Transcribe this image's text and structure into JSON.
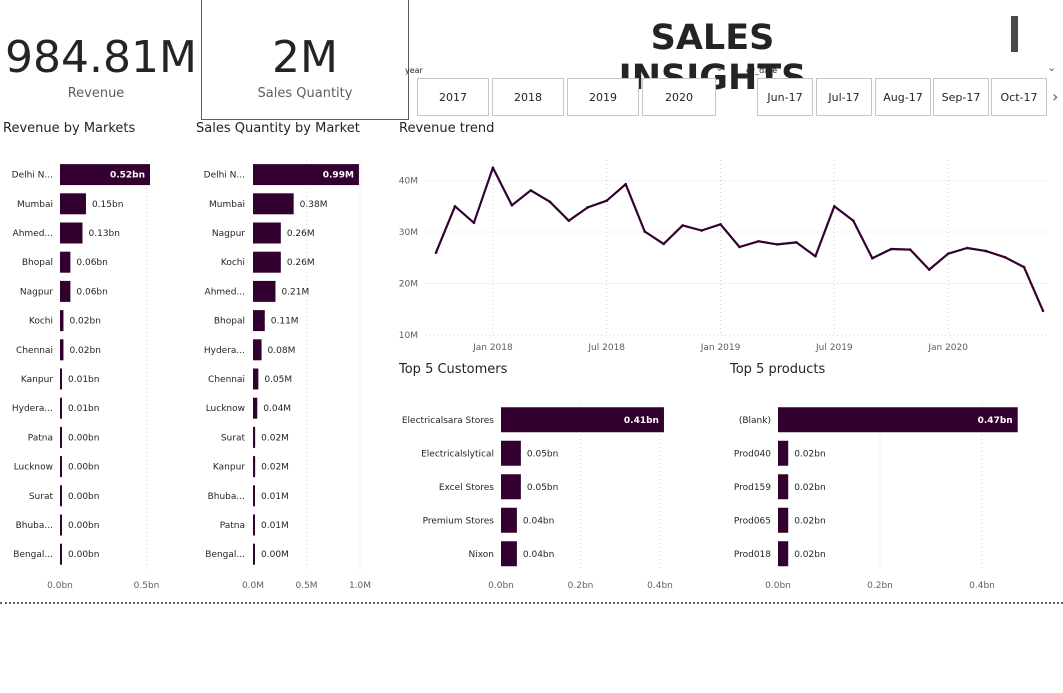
{
  "kpis": {
    "revenue": {
      "value": "984.81M",
      "label": "Revenue"
    },
    "quantity": {
      "value": "2M",
      "label": "Sales Quantity"
    }
  },
  "page_title": "SALES INSIGHTS",
  "year_slicer": {
    "label": "year",
    "options": [
      "2017",
      "2018",
      "2019",
      "2020"
    ]
  },
  "date_slicer": {
    "label": "cy_date",
    "options": [
      "Jun-17",
      "Jul-17",
      "Aug-17",
      "Sep-17",
      "Oct-17"
    ]
  },
  "colors": {
    "bar": "#33012f",
    "grid": "#d2d0ce",
    "text": "#252423",
    "muted": "#605e5c"
  },
  "chart_data": [
    {
      "id": "rev_markets",
      "type": "bar",
      "orientation": "horizontal",
      "title": "Revenue by Markets",
      "categories": [
        "Delhi N...",
        "Mumbai",
        "Ahmed...",
        "Bhopal",
        "Nagpur",
        "Kochi",
        "Chennai",
        "Kanpur",
        "Hydera...",
        "Patna",
        "Lucknow",
        "Surat",
        "Bhuba...",
        "Bengal..."
      ],
      "values": [
        0.52,
        0.15,
        0.13,
        0.06,
        0.06,
        0.02,
        0.02,
        0.01,
        0.01,
        0.0,
        0.0,
        0.0,
        0.0,
        0.0
      ],
      "data_labels": [
        "0.52bn",
        "0.15bn",
        "0.13bn",
        "0.06bn",
        "0.06bn",
        "0.02bn",
        "0.02bn",
        "0.01bn",
        "0.01bn",
        "0.00bn",
        "0.00bn",
        "0.00bn",
        "0.00bn",
        "0.00bn"
      ],
      "x_ticks": [
        {
          "v": 0,
          "label": "0.0bn"
        },
        {
          "v": 0.5,
          "label": "0.5bn"
        }
      ],
      "xlim": [
        0,
        0.52
      ]
    },
    {
      "id": "qty_markets",
      "type": "bar",
      "orientation": "horizontal",
      "title": "Sales Quantity by Market",
      "categories": [
        "Delhi N...",
        "Mumbai",
        "Nagpur",
        "Kochi",
        "Ahmed...",
        "Bhopal",
        "Hydera...",
        "Chennai",
        "Lucknow",
        "Surat",
        "Kanpur",
        "Bhuba...",
        "Patna",
        "Bengal..."
      ],
      "values": [
        0.99,
        0.38,
        0.26,
        0.26,
        0.21,
        0.11,
        0.08,
        0.05,
        0.04,
        0.02,
        0.02,
        0.01,
        0.01,
        0.0
      ],
      "data_labels": [
        "0.99M",
        "0.38M",
        "0.26M",
        "0.26M",
        "0.21M",
        "0.11M",
        "0.08M",
        "0.05M",
        "0.04M",
        "0.02M",
        "0.02M",
        "0.01M",
        "0.01M",
        "0.00M"
      ],
      "x_ticks": [
        {
          "v": 0,
          "label": "0.0M"
        },
        {
          "v": 0.5,
          "label": "0.5M"
        },
        {
          "v": 1.0,
          "label": "1.0M"
        }
      ],
      "xlim": [
        0,
        1.0
      ]
    },
    {
      "id": "rev_trend",
      "type": "line",
      "title": "Revenue trend",
      "x": [
        "2017-10",
        "2017-11",
        "2017-12",
        "2018-01",
        "2018-02",
        "2018-03",
        "2018-04",
        "2018-05",
        "2018-06",
        "2018-07",
        "2018-08",
        "2018-09",
        "2018-10",
        "2018-11",
        "2018-12",
        "2019-01",
        "2019-02",
        "2019-03",
        "2019-04",
        "2019-05",
        "2019-06",
        "2019-07",
        "2019-08",
        "2019-09",
        "2019-10",
        "2019-11",
        "2019-12",
        "2020-01",
        "2020-02",
        "2020-03",
        "2020-04",
        "2020-05",
        "2020-06"
      ],
      "y": [
        26.0,
        35.0,
        31.8,
        42.5,
        35.2,
        38.1,
        35.9,
        32.2,
        34.8,
        36.1,
        39.3,
        30.1,
        27.7,
        31.3,
        30.3,
        31.5,
        27.1,
        28.2,
        27.6,
        28.0,
        25.3,
        35.0,
        32.2,
        24.9,
        26.7,
        26.6,
        22.7,
        25.8,
        26.9,
        26.3,
        25.1,
        23.2,
        14.7
      ],
      "y_ticks": [
        {
          "v": 10,
          "label": "10M"
        },
        {
          "v": 20,
          "label": "20M"
        },
        {
          "v": 30,
          "label": "30M"
        },
        {
          "v": 40,
          "label": "40M"
        }
      ],
      "x_ticks": [
        {
          "i": 3,
          "label": "Jan 2018"
        },
        {
          "i": 9,
          "label": "Jul 2018"
        },
        {
          "i": 15,
          "label": "Jan 2019"
        },
        {
          "i": 21,
          "label": "Jul 2019"
        },
        {
          "i": 27,
          "label": "Jan 2020"
        }
      ],
      "ylim": [
        10,
        44
      ]
    },
    {
      "id": "top_customers",
      "type": "bar",
      "orientation": "horizontal",
      "title": "Top 5 Customers",
      "categories": [
        "Electricalsara Stores",
        "Electricalslytical",
        "Excel Stores",
        "Premium Stores",
        "Nixon"
      ],
      "values": [
        0.41,
        0.05,
        0.05,
        0.04,
        0.04
      ],
      "data_labels": [
        "0.41bn",
        "0.05bn",
        "0.05bn",
        "0.04bn",
        "0.04bn"
      ],
      "x_ticks": [
        {
          "v": 0,
          "label": "0.0bn"
        },
        {
          "v": 0.2,
          "label": "0.2bn"
        },
        {
          "v": 0.4,
          "label": "0.4bn"
        }
      ],
      "xlim": [
        0,
        0.4
      ]
    },
    {
      "id": "top_products",
      "type": "bar",
      "orientation": "horizontal",
      "title": "Top 5 products",
      "categories": [
        "(Blank)",
        "Prod040",
        "Prod159",
        "Prod065",
        "Prod018"
      ],
      "values": [
        0.47,
        0.02,
        0.02,
        0.02,
        0.02
      ],
      "data_labels": [
        "0.47bn",
        "0.02bn",
        "0.02bn",
        "0.02bn",
        "0.02bn"
      ],
      "x_ticks": [
        {
          "v": 0,
          "label": "0.0bn"
        },
        {
          "v": 0.2,
          "label": "0.2bn"
        },
        {
          "v": 0.4,
          "label": "0.4bn"
        }
      ],
      "xlim": [
        0,
        0.4
      ]
    }
  ]
}
